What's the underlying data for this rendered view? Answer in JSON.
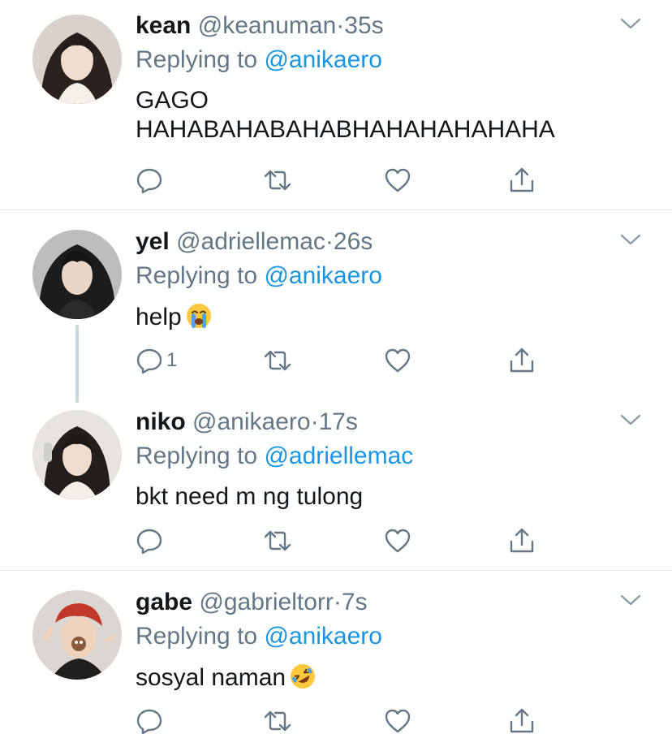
{
  "tweets": [
    {
      "name": "kean",
      "handle": "@keanuman",
      "separator": "·",
      "time": "35s",
      "reply_prefix": "Replying to",
      "reply_to": "@anikaero",
      "body_lines": [
        "GAGO",
        "HAHABAHABAHABHAHAHAHAHAHA"
      ],
      "reply_count": ""
    },
    {
      "name": "yel",
      "handle": "@adriellemac",
      "separator": "·",
      "time": "26s",
      "reply_prefix": "Replying to",
      "reply_to": "@anikaero",
      "body_lines": [
        "help"
      ],
      "emoji": "loudly-crying-face-emoji",
      "reply_count": "1"
    },
    {
      "name": "niko",
      "handle": "@anikaero",
      "separator": "·",
      "time": "17s",
      "reply_prefix": "Replying to",
      "reply_to": "@adriellemac",
      "body_lines": [
        "bkt need m ng tulong"
      ],
      "reply_count": ""
    },
    {
      "name": "gabe",
      "handle": "@gabrieltorr",
      "separator": "·",
      "time": "7s",
      "reply_prefix": "Replying to",
      "reply_to": "@anikaero",
      "body_lines": [
        "sosyal naman"
      ],
      "emoji": "rolling-on-floor-laughing-emoji",
      "reply_count": ""
    }
  ],
  "icons": {
    "reply": "reply-icon",
    "retweet": "retweet-icon",
    "like": "heart-icon",
    "share": "share-icon",
    "menu": "chevron-down-icon"
  },
  "colors": {
    "text": "#14171a",
    "secondary": "#657786",
    "link": "#1b95e0",
    "divider": "#e1e8ed"
  }
}
